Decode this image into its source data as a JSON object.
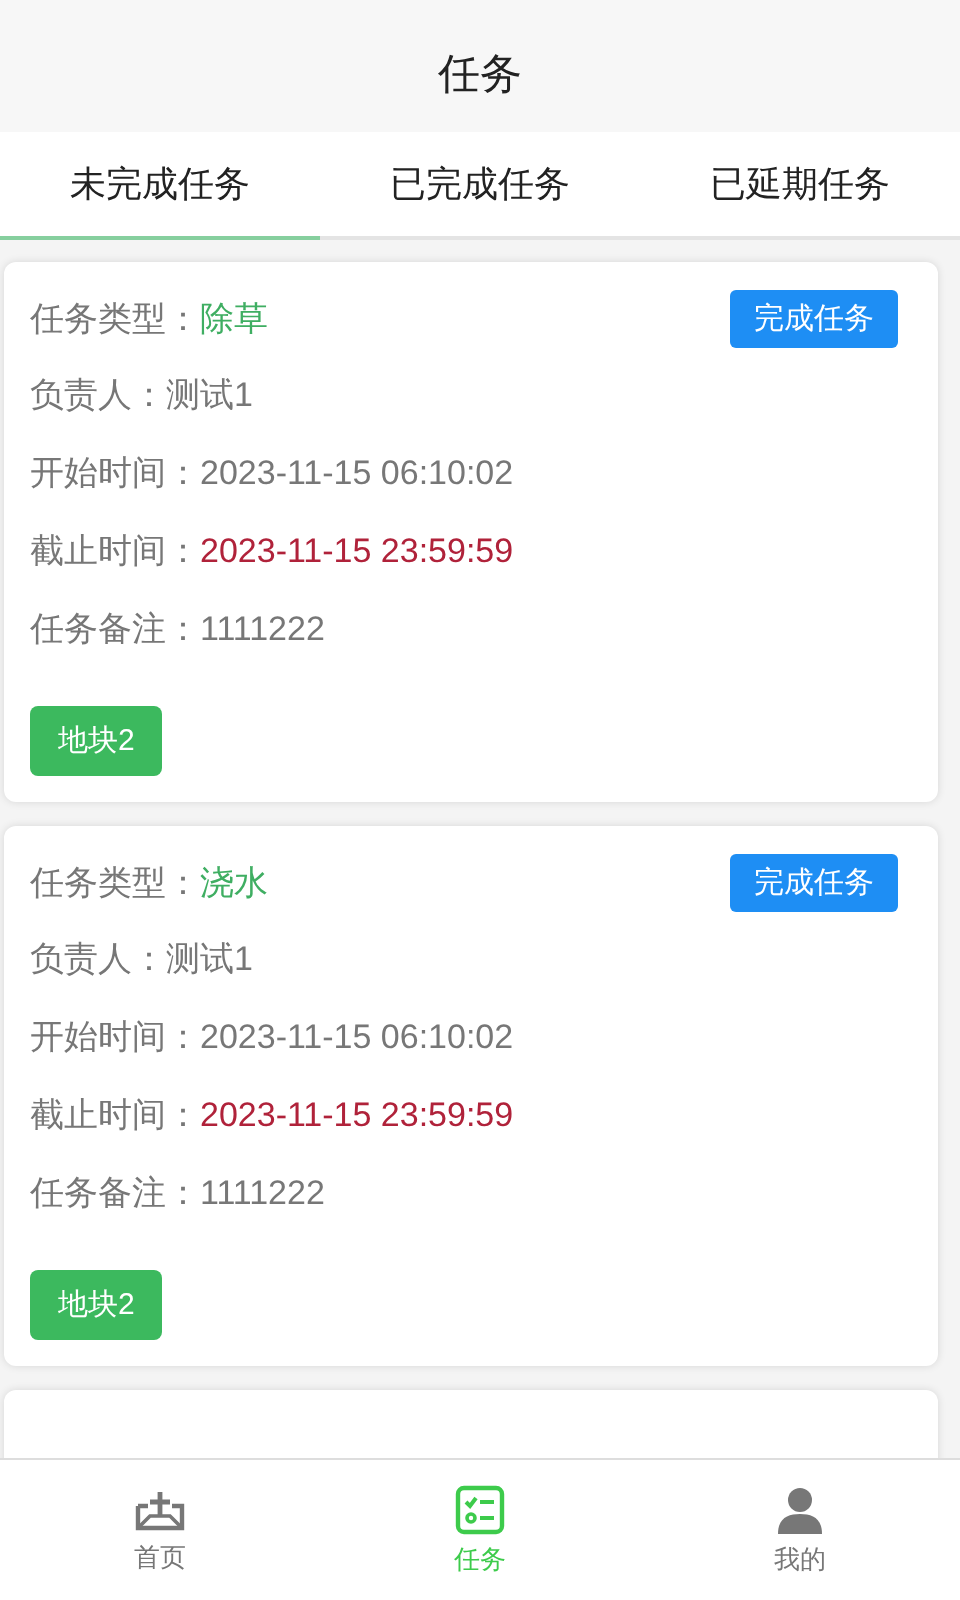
{
  "header": {
    "title": "任务"
  },
  "tabs": [
    {
      "label": "未完成任务",
      "selected": true
    },
    {
      "label": "已完成任务",
      "selected": false
    },
    {
      "label": "已延期任务",
      "selected": false
    }
  ],
  "tasks": [
    {
      "type_label": "任务类型：",
      "type": "除草",
      "action": "完成任务",
      "fields": [
        {
          "kind": "plain",
          "label": "负责人：",
          "value": "测试1"
        },
        {
          "kind": "plain",
          "label": "开始时间：",
          "value": "2023-11-15 06:10:02"
        },
        {
          "kind": "deadline",
          "label": "截止时间：",
          "value": "2023-11-15 23:59:59"
        },
        {
          "kind": "plain",
          "label": "任务备注：",
          "value": "1111222"
        }
      ],
      "tags": [
        "地块2"
      ]
    },
    {
      "type_label": "任务类型：",
      "type": "浇水",
      "action": "完成任务",
      "fields": [
        {
          "kind": "plain",
          "label": "负责人：",
          "value": "测试1"
        },
        {
          "kind": "plain",
          "label": "开始时间：",
          "value": "2023-11-15 06:10:02"
        },
        {
          "kind": "deadline",
          "label": "截止时间：",
          "value": "2023-11-15 23:59:59"
        },
        {
          "kind": "plain",
          "label": "任务备注：",
          "value": "1111222"
        }
      ],
      "tags": [
        "地块2"
      ]
    }
  ],
  "more_cards_below": true,
  "nav": [
    {
      "kind": "home",
      "label": "首页",
      "selected": false
    },
    {
      "kind": "tasks",
      "label": "任务",
      "selected": true
    },
    {
      "kind": "user",
      "label": "我的",
      "selected": false
    }
  ]
}
